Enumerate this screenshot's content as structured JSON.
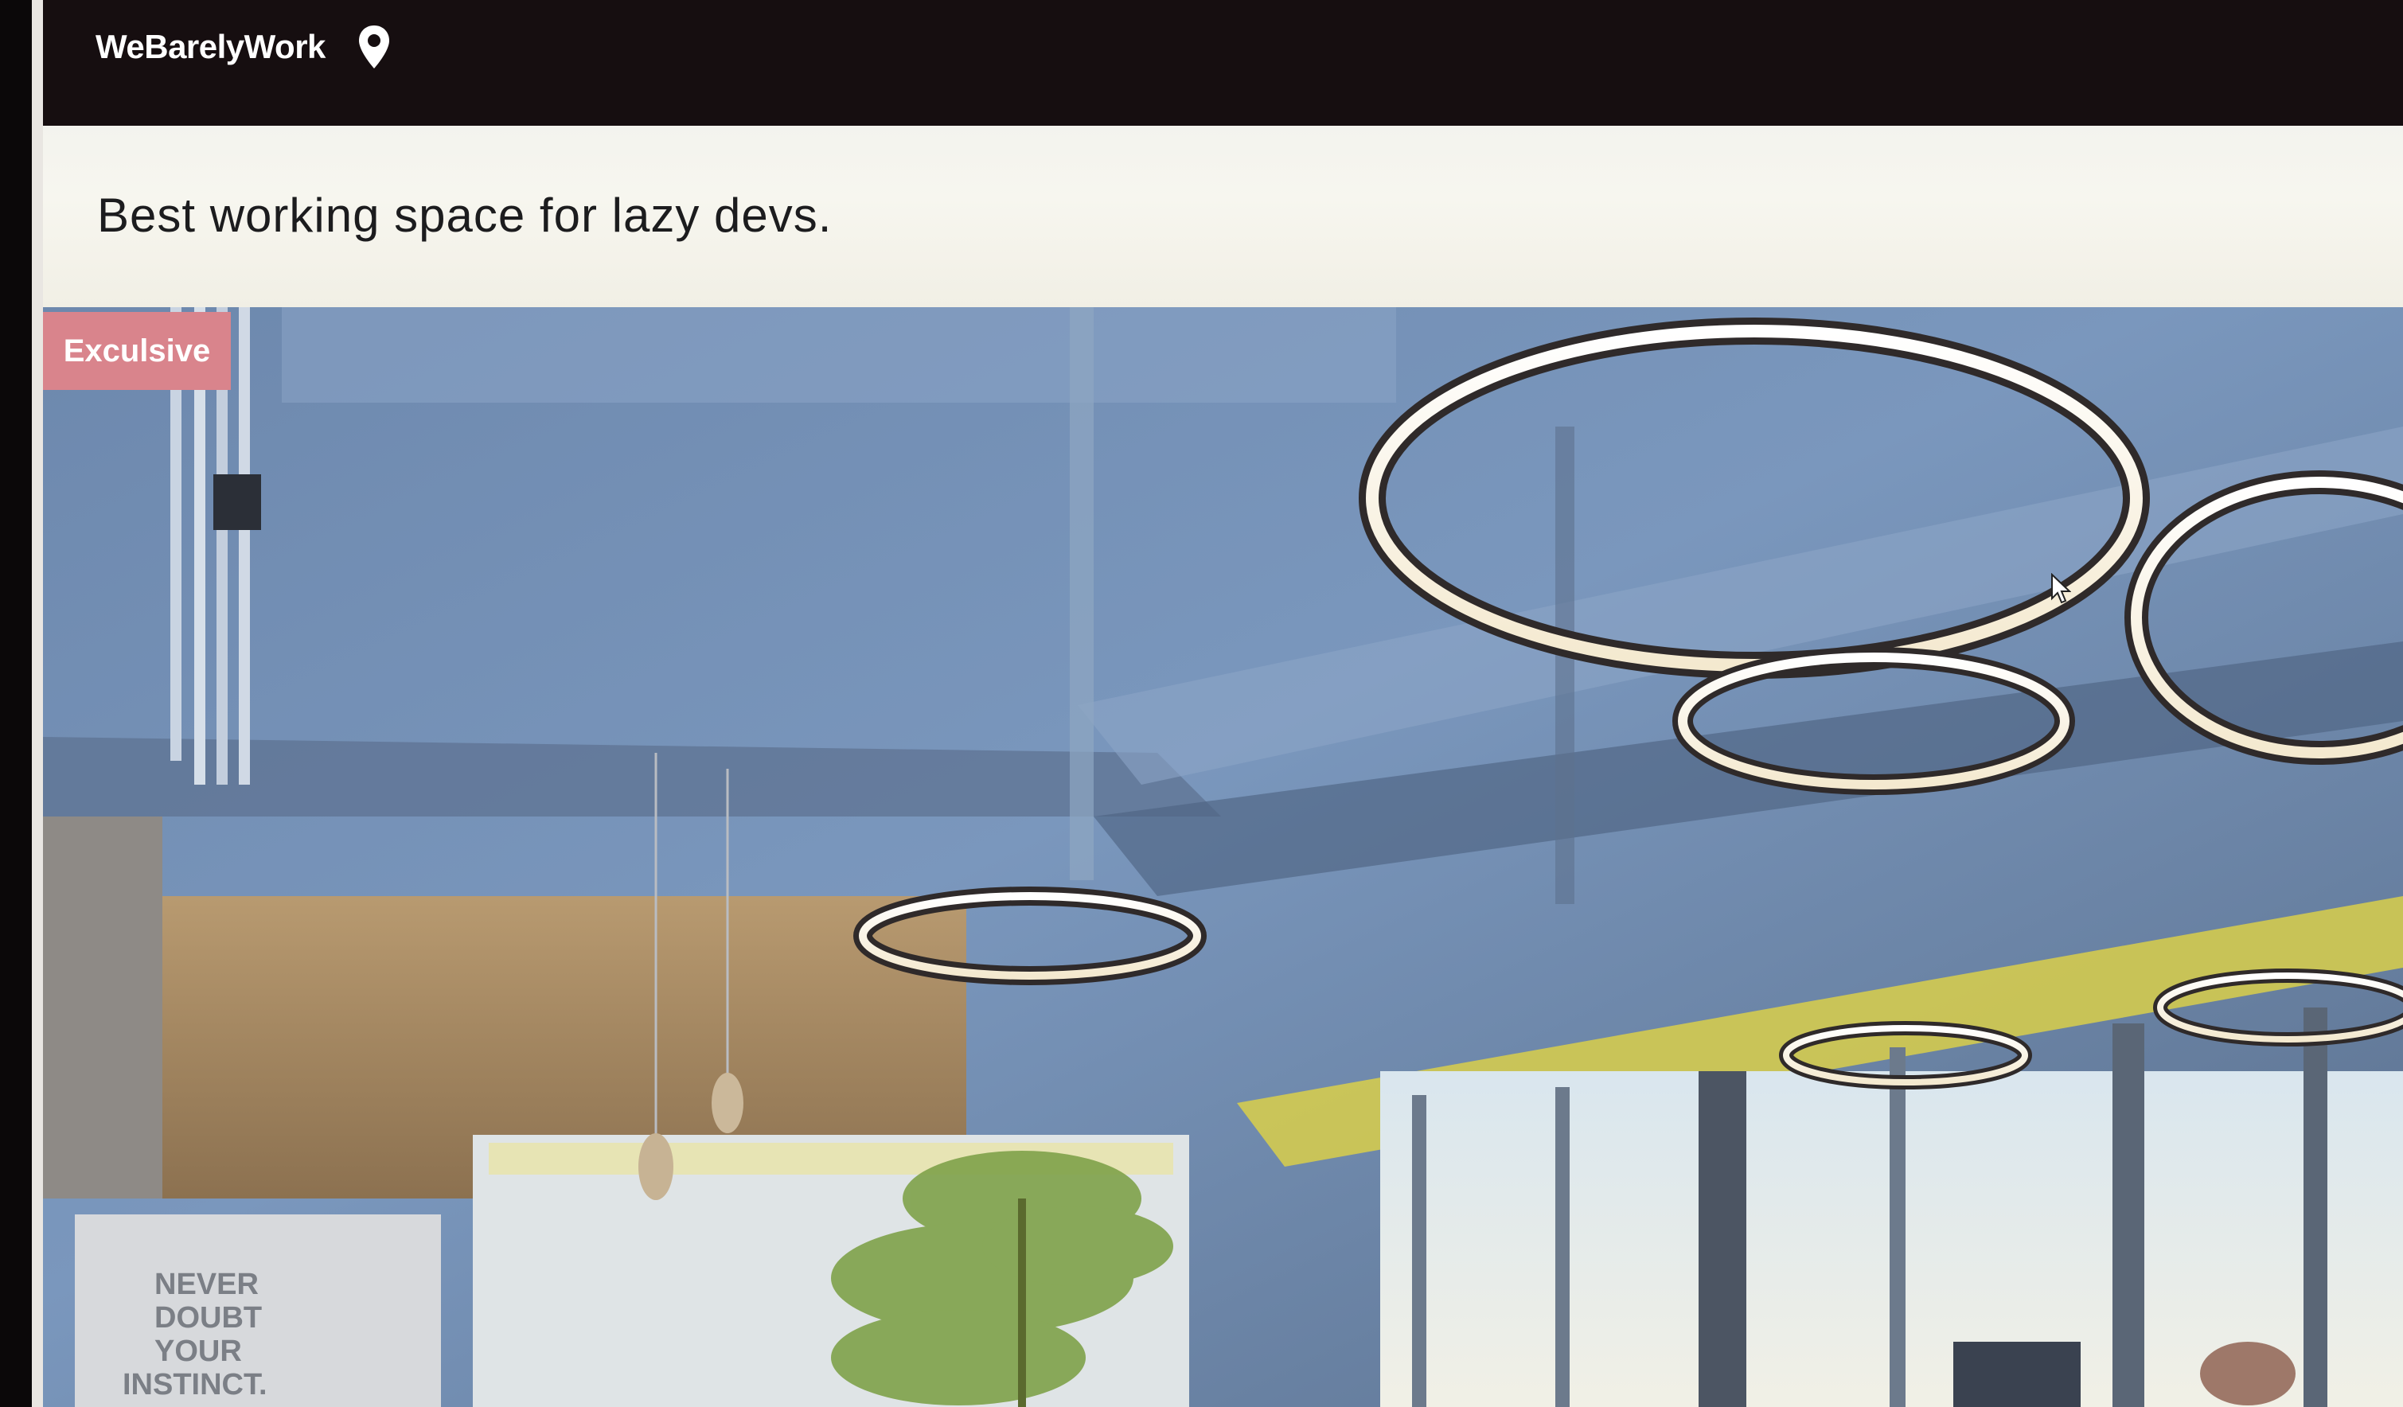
{
  "navbar": {
    "brand": "WeBarelyWork",
    "location_icon": "map-pin-icon"
  },
  "hero": {
    "tagline": "Best working space for lazy devs."
  },
  "listing": {
    "badge": "Exculsive",
    "photo_icon": "coworking-office-photo",
    "wall_sign": "NEVER DOUBT YOUR INSTINCT."
  },
  "colors": {
    "navbar_bg": "#160e10",
    "badge_bg": "#d9848c",
    "hero_bg": "#f5f4ec"
  }
}
